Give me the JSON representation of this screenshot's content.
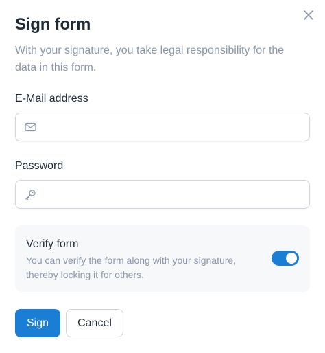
{
  "dialog": {
    "title": "Sign form",
    "subtitle": "With your signature, you take legal responsibility for the data in this form.",
    "close_icon": "close-icon"
  },
  "email": {
    "label": "E-Mail address",
    "value": "",
    "placeholder": "",
    "icon": "mail-icon"
  },
  "password": {
    "label": "Password",
    "value": "",
    "placeholder": "",
    "icon": "key-icon"
  },
  "verify": {
    "title": "Verify form",
    "description": "You can verify the form along with your signature, thereby locking it for others.",
    "enabled": true
  },
  "actions": {
    "sign_label": "Sign",
    "cancel_label": "Cancel"
  },
  "colors": {
    "accent": "#1a7fd4",
    "muted_text": "#8a97ab",
    "text": "#1f2a37",
    "card_bg": "#f6f8fa"
  }
}
